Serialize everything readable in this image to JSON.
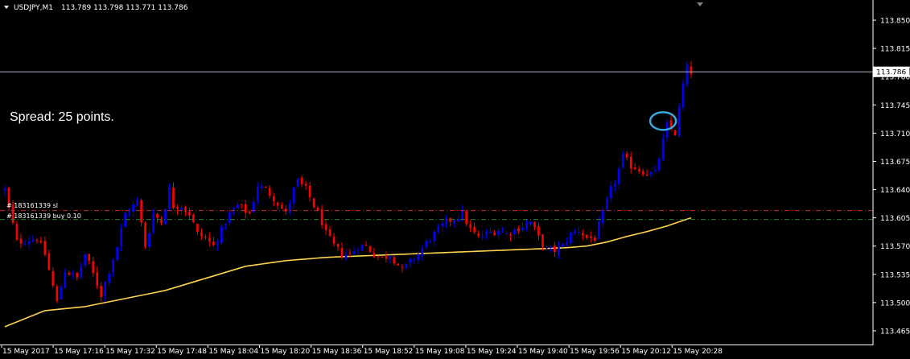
{
  "header": {
    "symbol": "USDJPY,M1",
    "ohlc": "113.789 113.798 113.771 113.786"
  },
  "annotation": {
    "spread_text": "Spread: 25 points."
  },
  "orders": {
    "sl_label": "# 183161339 sl",
    "buy_label": "# 183161339 buy 0.10"
  },
  "colors": {
    "background": "#000000",
    "bull": "#0000ff",
    "bear": "#ff0000",
    "ma": "#ffd24d",
    "sl_line": "#c62828",
    "buy_line": "#2e7d32",
    "bid_line": "#b0b8c8",
    "highlight_circle": "#3aa7e0",
    "axis": "#ffffff"
  },
  "chart_data": {
    "type": "candlestick",
    "symbol": "USDJPY",
    "timeframe": "M1",
    "ylim": [
      113.45,
      113.875
    ],
    "y_ticks": [
      "113.850",
      "113.815",
      "113.780",
      "113.745",
      "113.710",
      "113.675",
      "113.640",
      "113.605",
      "113.570",
      "113.535",
      "113.500",
      "113.465"
    ],
    "x_ticks": [
      "15 May 2017",
      "15 May 17:16",
      "15 May 17:32",
      "15 May 17:48",
      "15 May 18:04",
      "15 May 18:20",
      "15 May 18:36",
      "15 May 18:52",
      "15 May 19:08",
      "15 May 19:24",
      "15 May 19:40",
      "15 May 19:56",
      "15 May 20:12",
      "15 May 20:28"
    ],
    "current_price": {
      "value": 113.786,
      "label": "113.786"
    },
    "sl_level": 113.614,
    "buy_level": 113.603,
    "close_path": [
      [
        0,
        113.64
      ],
      [
        3,
        113.575
      ],
      [
        8,
        113.58
      ],
      [
        10,
        113.56
      ],
      [
        13,
        113.5
      ],
      [
        15,
        113.54
      ],
      [
        18,
        113.53
      ],
      [
        20,
        113.56
      ],
      [
        22,
        113.535
      ],
      [
        24,
        113.51
      ],
      [
        26,
        113.54
      ],
      [
        28,
        113.57
      ],
      [
        30,
        113.61
      ],
      [
        33,
        113.625
      ],
      [
        35,
        113.57
      ],
      [
        37,
        113.61
      ],
      [
        39,
        113.6
      ],
      [
        41,
        113.64
      ],
      [
        42,
        113.62
      ],
      [
        44,
        113.62
      ],
      [
        46,
        113.61
      ],
      [
        48,
        113.585
      ],
      [
        50,
        113.58
      ],
      [
        52,
        113.57
      ],
      [
        54,
        113.59
      ],
      [
        56,
        113.61
      ],
      [
        58,
        113.62
      ],
      [
        61,
        113.61
      ],
      [
        63,
        113.645
      ],
      [
        65,
        113.64
      ],
      [
        67,
        113.63
      ],
      [
        70,
        113.61
      ],
      [
        72,
        113.64
      ],
      [
        73,
        113.65
      ],
      [
        75,
        113.64
      ],
      [
        77,
        113.62
      ],
      [
        79,
        113.6
      ],
      [
        80,
        113.585
      ],
      [
        82,
        113.57
      ],
      [
        84,
        113.56
      ],
      [
        86,
        113.56
      ],
      [
        88,
        113.57
      ],
      [
        90,
        113.57
      ],
      [
        92,
        113.56
      ],
      [
        94,
        113.555
      ],
      [
        96,
        113.56
      ],
      [
        99,
        113.54
      ],
      [
        101,
        113.55
      ],
      [
        103,
        113.56
      ],
      [
        106,
        113.58
      ],
      [
        108,
        113.59
      ],
      [
        110,
        113.6
      ],
      [
        112,
        113.605
      ],
      [
        114,
        113.61
      ],
      [
        116,
        113.59
      ],
      [
        118,
        113.58
      ],
      [
        120,
        113.585
      ],
      [
        123,
        113.59
      ],
      [
        125,
        113.585
      ],
      [
        127,
        113.59
      ],
      [
        129,
        113.595
      ],
      [
        131,
        113.6
      ],
      [
        133,
        113.58
      ],
      [
        135,
        113.565
      ],
      [
        137,
        113.565
      ],
      [
        139,
        113.57
      ],
      [
        141,
        113.585
      ],
      [
        143,
        113.59
      ],
      [
        145,
        113.58
      ],
      [
        147,
        113.58
      ],
      [
        149,
        113.61
      ],
      [
        151,
        113.64
      ],
      [
        152,
        113.65
      ],
      [
        154,
        113.68
      ],
      [
        156,
        113.67
      ],
      [
        158,
        113.665
      ],
      [
        160,
        113.66
      ],
      [
        162,
        113.66
      ],
      [
        164,
        113.7
      ],
      [
        165,
        113.72
      ],
      [
        167,
        113.71
      ],
      [
        168,
        113.74
      ],
      [
        169,
        113.77
      ],
      [
        170,
        113.79
      ],
      [
        171,
        113.786
      ]
    ],
    "ma_path": [
      [
        0,
        113.47
      ],
      [
        10,
        113.49
      ],
      [
        20,
        113.495
      ],
      [
        30,
        113.505
      ],
      [
        40,
        113.515
      ],
      [
        50,
        113.53
      ],
      [
        60,
        113.545
      ],
      [
        70,
        113.552
      ],
      [
        80,
        113.556
      ],
      [
        90,
        113.558
      ],
      [
        100,
        113.56
      ],
      [
        110,
        113.562
      ],
      [
        120,
        113.564
      ],
      [
        130,
        113.566
      ],
      [
        140,
        113.568
      ],
      [
        145,
        113.57
      ],
      [
        150,
        113.575
      ],
      [
        155,
        113.582
      ],
      [
        160,
        113.588
      ],
      [
        165,
        113.595
      ],
      [
        171,
        113.605
      ]
    ],
    "highlight": {
      "bar": 164,
      "price": 113.725
    }
  }
}
